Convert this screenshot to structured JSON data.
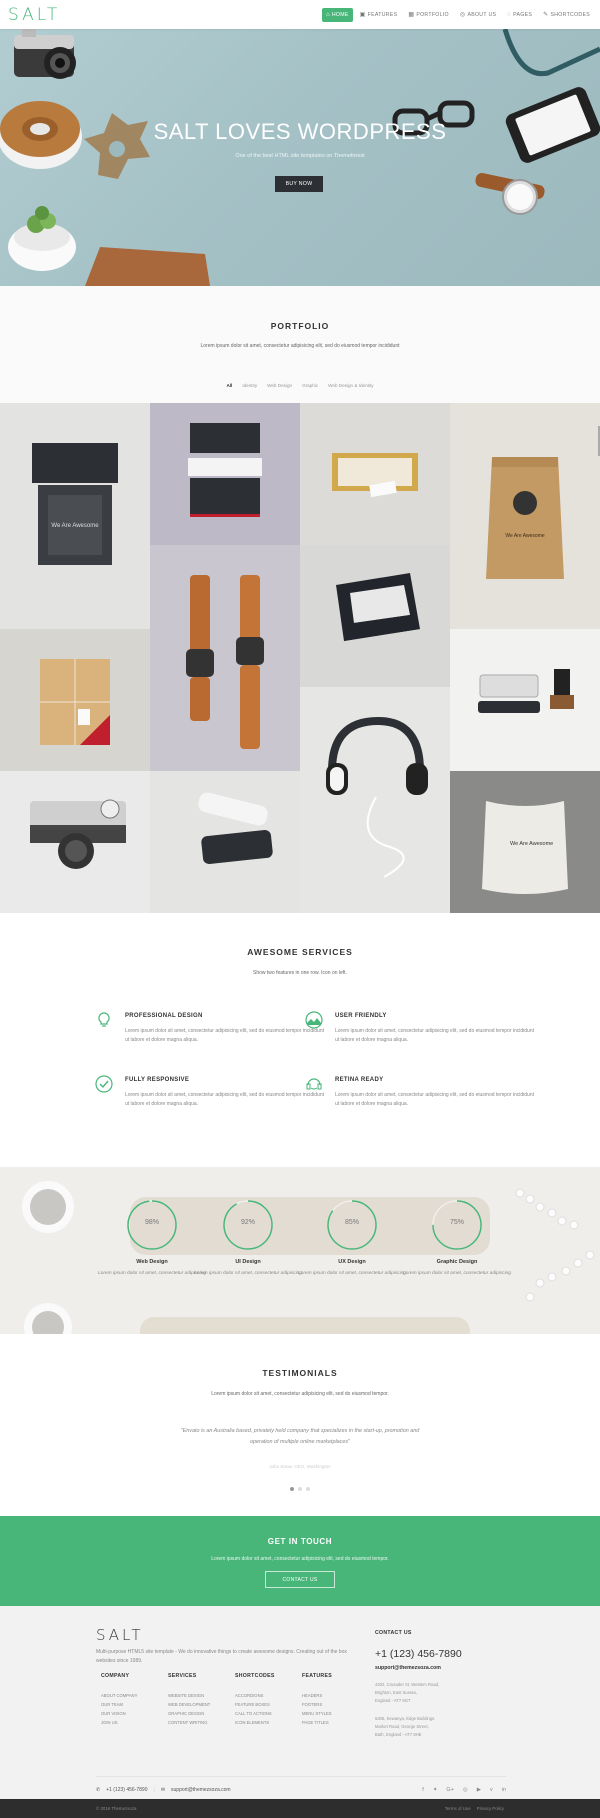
{
  "header": {
    "logo": "SALT",
    "nav": [
      {
        "label": "HOME",
        "icon": "home-icon",
        "glyph": "⌂",
        "active": true
      },
      {
        "label": "FEATURES",
        "icon": "features-icon",
        "glyph": "▣",
        "active": false
      },
      {
        "label": "PORTFOLIO",
        "icon": "portfolio-icon",
        "glyph": "▦",
        "active": false
      },
      {
        "label": "ABOUT US",
        "icon": "about-icon",
        "glyph": "◎",
        "active": false
      },
      {
        "label": "PAGES",
        "icon": "pages-icon",
        "glyph": "◌",
        "active": false
      },
      {
        "label": "SHORTCODES",
        "icon": "shortcodes-icon",
        "glyph": "✎",
        "active": false
      }
    ]
  },
  "hero": {
    "title": "SALT LOVES WORDPRESS",
    "subtitle": "One of the best HTML site templates on Themeforest",
    "button": "BUY NOW"
  },
  "portfolio": {
    "title": "PORTFOLIO",
    "subtitle": "Lorem ipsum dolor sit amet, consectetur adipisicing elit, sed do eiusmod tempor incididunt",
    "filters": [
      {
        "label": "All",
        "active": true
      },
      {
        "label": "Identity",
        "active": false
      },
      {
        "label": "Web Design",
        "active": false
      },
      {
        "label": "Graphic",
        "active": false
      },
      {
        "label": "Web Design & Identity",
        "active": false
      }
    ],
    "tile_captions": {
      "box": "We Are Awesome",
      "bag": "We Are Awesome",
      "pouch": "We Are Awesome"
    }
  },
  "services": {
    "title": "AWESOME SERVICES",
    "subtitle": "Show two features in one row. Icon on left.",
    "items": [
      {
        "title": "PROFESSIONAL DESIGN",
        "icon": "lightbulb-icon",
        "text": "Lorem ipsum dolor sit amet, consectetur adipisicing elit, sed do eiusmod tempor incididunt ut labore et dolore magna aliqua."
      },
      {
        "title": "USER FRIENDLY",
        "icon": "landscape-icon",
        "text": "Lorem ipsum dolor sit amet, consectetur adipisicing elit, sed do eiusmod tempor incididunt ut labore et dolore magna aliqua."
      },
      {
        "title": "FULLY RESPONSIVE",
        "icon": "check-circle-icon",
        "text": "Lorem ipsum dolor sit amet, consectetur adipisicing elit, sed do eiusmod tempor incididunt ut labore et dolore magna aliqua."
      },
      {
        "title": "RETINA READY",
        "icon": "support-icon",
        "text": "Lorem ipsum dolor sit amet, consectetur adipisicing elit, sed do eiusmod tempor incididunt ut labore et dolore magna aliqua."
      }
    ]
  },
  "skills": [
    {
      "name": "Web Design",
      "percent": 98,
      "label": "98%",
      "text": "Lorem ipsum dolor sit amet, consectetur adipiscing"
    },
    {
      "name": "UI Design",
      "percent": 92,
      "label": "92%",
      "text": "Lorem ipsum dolor sit amet, consectetur adipiscing"
    },
    {
      "name": "UX Design",
      "percent": 85,
      "label": "85%",
      "text": "Lorem ipsum dolor sit amet, consectetur adipiscing"
    },
    {
      "name": "Graphic Design",
      "percent": 75,
      "label": "75%",
      "text": "Lorem ipsum dolor sit amet, consectetur adipiscing"
    }
  ],
  "testimonials": {
    "title": "TESTIMONIALS",
    "subtitle": "Lorem ipsum dolor sit amet, consectetur adipisicing elit, sed do eiusmod tempor.",
    "quote": "\"Envato is an Australia based, privately held company that specializes in the start-up, promotion and operation of multiple online marketplaces\"",
    "author": "John Snow, CEO, Washington",
    "dots": 3,
    "active_dot": 0
  },
  "cta": {
    "title": "GET IN TOUCH",
    "subtitle": "Lorem ipsum dolor sit amet, consectetur adipisicing elit, sed do eiusmod tempor.",
    "button": "CONTACT US"
  },
  "footer": {
    "logo": "SALT",
    "description": "Multi-purpose HTML5 site template - We do innovative things to create awesome designs. Creating out of the box websites since 1989.",
    "columns": [
      {
        "title": "COMPANY",
        "items": [
          "ABOUT COMPANY",
          "OUR TEAM",
          "OUR VISION",
          "JOIN US"
        ]
      },
      {
        "title": "SERVICES",
        "items": [
          "WEBSITE DESIGN",
          "WEB DEVELOPMENT",
          "GRAPHIC DESIGN",
          "CONTENT WRITING"
        ]
      },
      {
        "title": "SHORTCODES",
        "items": [
          "ACCORDIONS",
          "FEATURE BOXES",
          "CALL TO ACTIONS",
          "ICON ELEMENTS"
        ]
      },
      {
        "title": "FEATURES",
        "items": [
          "HEADERS",
          "FOOTERS",
          "MENU STYLES",
          "PAGE TITLES"
        ]
      }
    ],
    "contact": {
      "title": "CONTACT US",
      "phone": "+1 (123) 456-7890",
      "email": "support@themezsoza.com",
      "address1": [
        "4402, Crusader St, Western Road,",
        "Brighton, East Sussex,",
        "England - AT7 9GT"
      ],
      "address2": [
        "6305, Kewanya, Edge Buildings,",
        "Market Road, George Street,",
        "Bath, England - AT7 8HE"
      ]
    },
    "bar_phone": "+1 (123) 456-7890",
    "bar_email": "support@themezsoza.com",
    "socials": [
      {
        "icon": "facebook-icon",
        "glyph": "f"
      },
      {
        "icon": "twitter-icon",
        "glyph": "✦"
      },
      {
        "icon": "googleplus-icon",
        "glyph": "G+"
      },
      {
        "icon": "instagram-icon",
        "glyph": "◎"
      },
      {
        "icon": "youtube-icon",
        "glyph": "▶"
      },
      {
        "icon": "vimeo-icon",
        "glyph": "v"
      },
      {
        "icon": "linkedin-icon",
        "glyph": "in"
      }
    ],
    "copyright": "© 2016 Themezsoza",
    "bottom_links": [
      "Terms of Use",
      "Privacy Policy"
    ]
  },
  "colors": {
    "accent": "#48b679",
    "dark": "#2d2d2d"
  }
}
